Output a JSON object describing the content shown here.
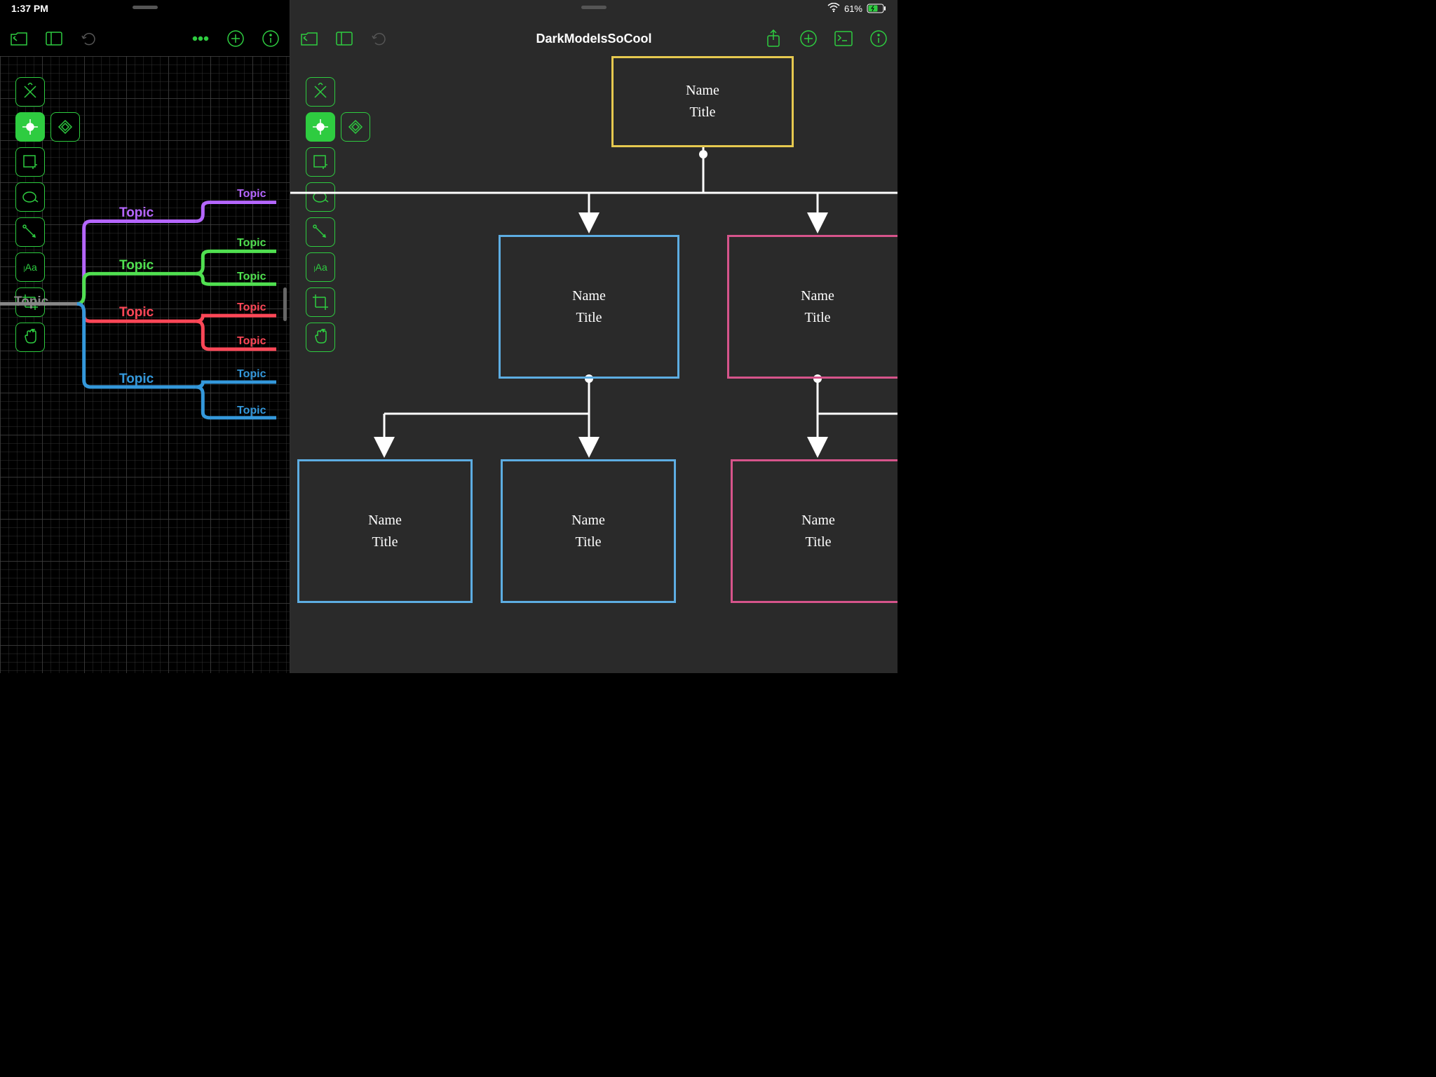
{
  "status": {
    "time": "1:37 PM",
    "battery_text": "61%"
  },
  "document_title": "DarkModeIsSoCool",
  "colors": {
    "green": "#2ecc40",
    "purple": "#b566ff",
    "lime": "#50e050",
    "red": "#ff4757",
    "blue": "#3498db",
    "yellow": "#e6c94f",
    "lightblue": "#5dade2",
    "pink": "#d6548b",
    "gray": "#888"
  },
  "left_mindmap": {
    "root": "Topic",
    "branches": [
      {
        "label": "Topic",
        "color": "purple",
        "children": [
          "Topic"
        ]
      },
      {
        "label": "Topic",
        "color": "lime",
        "children": [
          "Topic",
          "Topic"
        ]
      },
      {
        "label": "Topic",
        "color": "red",
        "children": [
          "Topic",
          "Topic"
        ]
      },
      {
        "label": "Topic",
        "color": "blue",
        "children": [
          "Topic",
          "Topic"
        ]
      }
    ]
  },
  "org_chart": {
    "nodes": [
      {
        "name": "Name",
        "title": "Title",
        "color": "yellow"
      },
      {
        "name": "Name",
        "title": "Title",
        "color": "lightblue"
      },
      {
        "name": "Name",
        "title": "Title",
        "color": "pink"
      },
      {
        "name": "Name",
        "title": "Title",
        "color": "lightblue"
      },
      {
        "name": "Name",
        "title": "Title",
        "color": "lightblue"
      },
      {
        "name": "Name",
        "title": "Title",
        "color": "pink"
      }
    ]
  },
  "tools": {
    "pen": "pen",
    "target": "target",
    "diamond": "diamond",
    "square": "square",
    "ellipse": "ellipse",
    "connector": "connector",
    "text": "Aa",
    "crop": "crop",
    "hand": "hand"
  }
}
